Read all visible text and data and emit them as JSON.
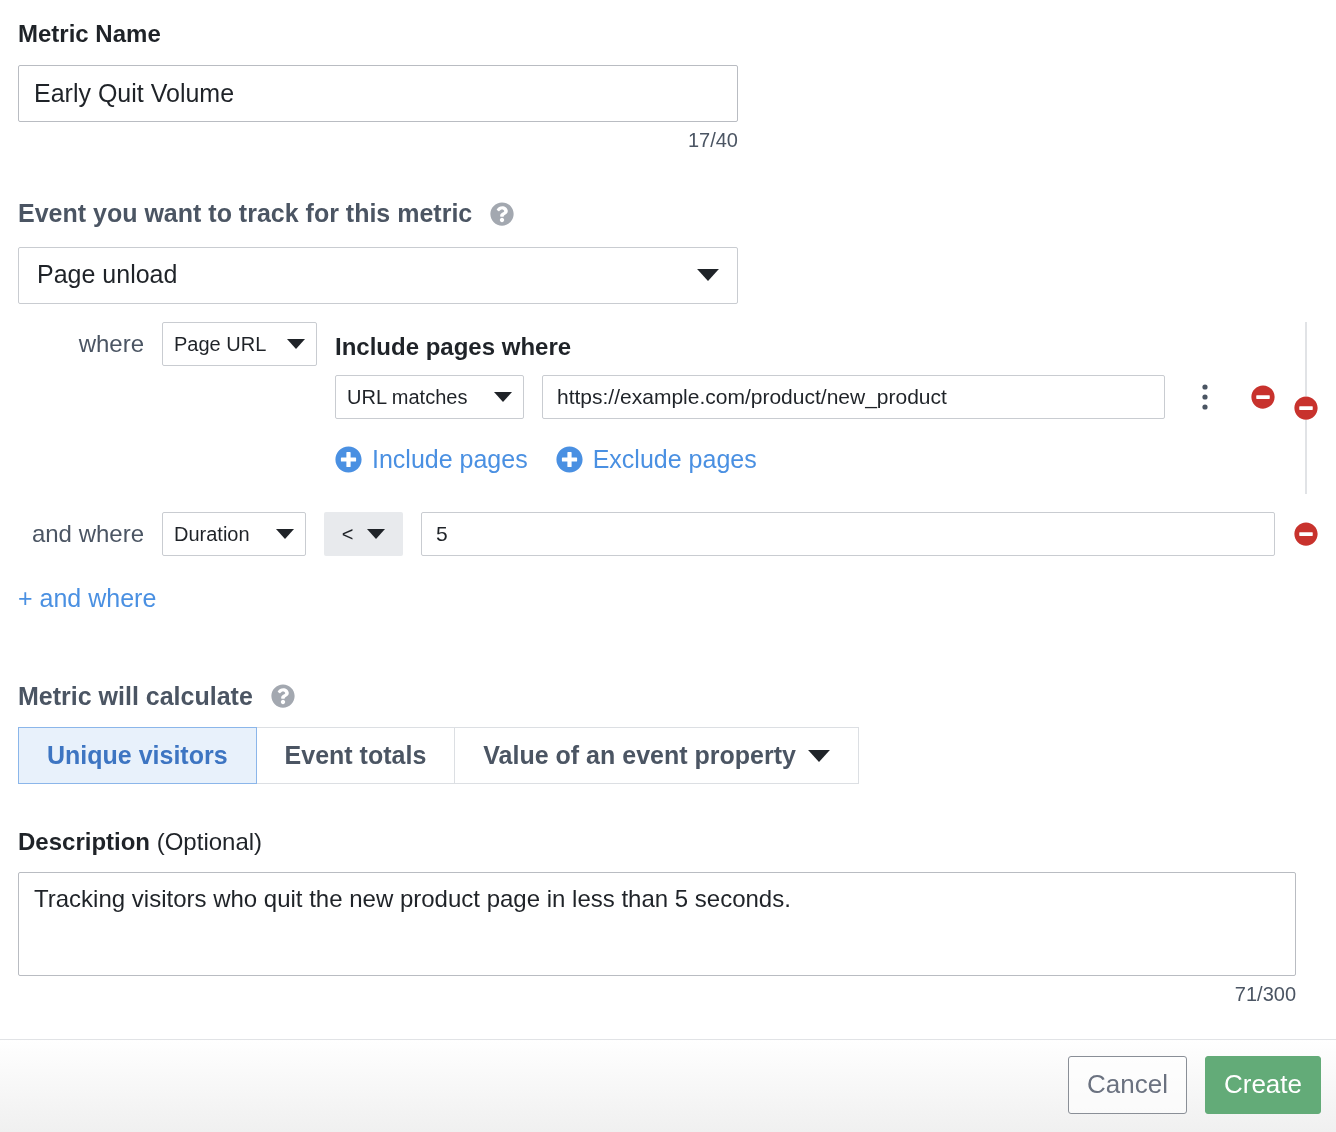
{
  "metric_name": {
    "label": "Metric Name",
    "value": "Early Quit Volume",
    "counter": "17/40"
  },
  "event": {
    "label": "Event you want to track for this metric",
    "value": "Page unload"
  },
  "conditions": [
    {
      "kind": "page_filter",
      "connector": "where",
      "property": "Page URL",
      "group_title": "Include pages where",
      "rules": [
        {
          "operator": "URL matches",
          "value": "https://example.com/product/new_product"
        }
      ],
      "add_links": [
        "Include pages",
        "Exclude pages"
      ]
    },
    {
      "kind": "comparison",
      "connector": "and where",
      "property": "Duration",
      "operator": "<",
      "value": "5"
    }
  ],
  "add_condition": "+ and where",
  "calculate": {
    "label": "Metric will calculate",
    "options": [
      {
        "kind": "option",
        "label": "Unique visitors",
        "selected": true
      },
      {
        "kind": "option",
        "label": "Event totals",
        "selected": false
      },
      {
        "kind": "dropdown",
        "label": "Value of an event property",
        "selected": false
      }
    ]
  },
  "description": {
    "label": "Description",
    "optional": "(Optional)",
    "value": "Tracking visitors who quit the new product page in less than 5 seconds.",
    "counter": "71/300"
  },
  "buttons": [
    {
      "kind": "secondary",
      "label": "Cancel"
    },
    {
      "kind": "primary",
      "label": "Create"
    }
  ]
}
